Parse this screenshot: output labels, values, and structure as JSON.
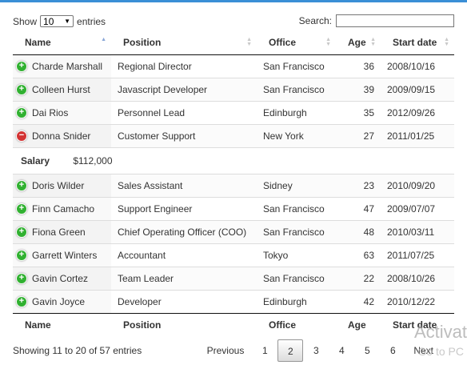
{
  "length": {
    "show_label": "Show",
    "value": "10",
    "entries_label": "entries"
  },
  "search": {
    "label": "Search:",
    "value": ""
  },
  "columns": [
    "Name",
    "Position",
    "Office",
    "Age",
    "Start date"
  ],
  "rows": [
    {
      "name": "Charde Marshall",
      "position": "Regional Director",
      "office": "San Francisco",
      "age": "36",
      "start": "2008/10/16",
      "control": "plus"
    },
    {
      "name": "Colleen Hurst",
      "position": "Javascript Developer",
      "office": "San Francisco",
      "age": "39",
      "start": "2009/09/15",
      "control": "plus"
    },
    {
      "name": "Dai Rios",
      "position": "Personnel Lead",
      "office": "Edinburgh",
      "age": "35",
      "start": "2012/09/26",
      "control": "plus"
    },
    {
      "name": "Donna Snider",
      "position": "Customer Support",
      "office": "New York",
      "age": "27",
      "start": "2011/01/25",
      "control": "minus"
    },
    {
      "name": "Doris Wilder",
      "position": "Sales Assistant",
      "office": "Sidney",
      "age": "23",
      "start": "2010/09/20",
      "control": "plus"
    },
    {
      "name": "Finn Camacho",
      "position": "Support Engineer",
      "office": "San Francisco",
      "age": "47",
      "start": "2009/07/07",
      "control": "plus"
    },
    {
      "name": "Fiona Green",
      "position": "Chief Operating Officer (COO)",
      "office": "San Francisco",
      "age": "48",
      "start": "2010/03/11",
      "control": "plus"
    },
    {
      "name": "Garrett Winters",
      "position": "Accountant",
      "office": "Tokyo",
      "age": "63",
      "start": "2011/07/25",
      "control": "plus"
    },
    {
      "name": "Gavin Cortez",
      "position": "Team Leader",
      "office": "San Francisco",
      "age": "22",
      "start": "2008/10/26",
      "control": "plus"
    },
    {
      "name": "Gavin Joyce",
      "position": "Developer",
      "office": "Edinburgh",
      "age": "42",
      "start": "2010/12/22",
      "control": "plus"
    }
  ],
  "child_row": {
    "label": "Salary",
    "value": "$112,000"
  },
  "info": "Showing 11 to 20 of 57 entries",
  "pager": {
    "previous": "Previous",
    "pages": [
      "1",
      "2",
      "3",
      "4",
      "5",
      "6"
    ],
    "current": "2",
    "next": "Next"
  },
  "watermark": {
    "line1": "Activat",
    "line2": "Go to PC"
  },
  "colors": {
    "accent": "#3a8fd6",
    "expand": "#31b131",
    "collapse": "#d33333"
  },
  "icons": {
    "expand": "plus-circle-icon",
    "collapse": "minus-circle-icon",
    "sort": "sort-arrows-icon"
  }
}
